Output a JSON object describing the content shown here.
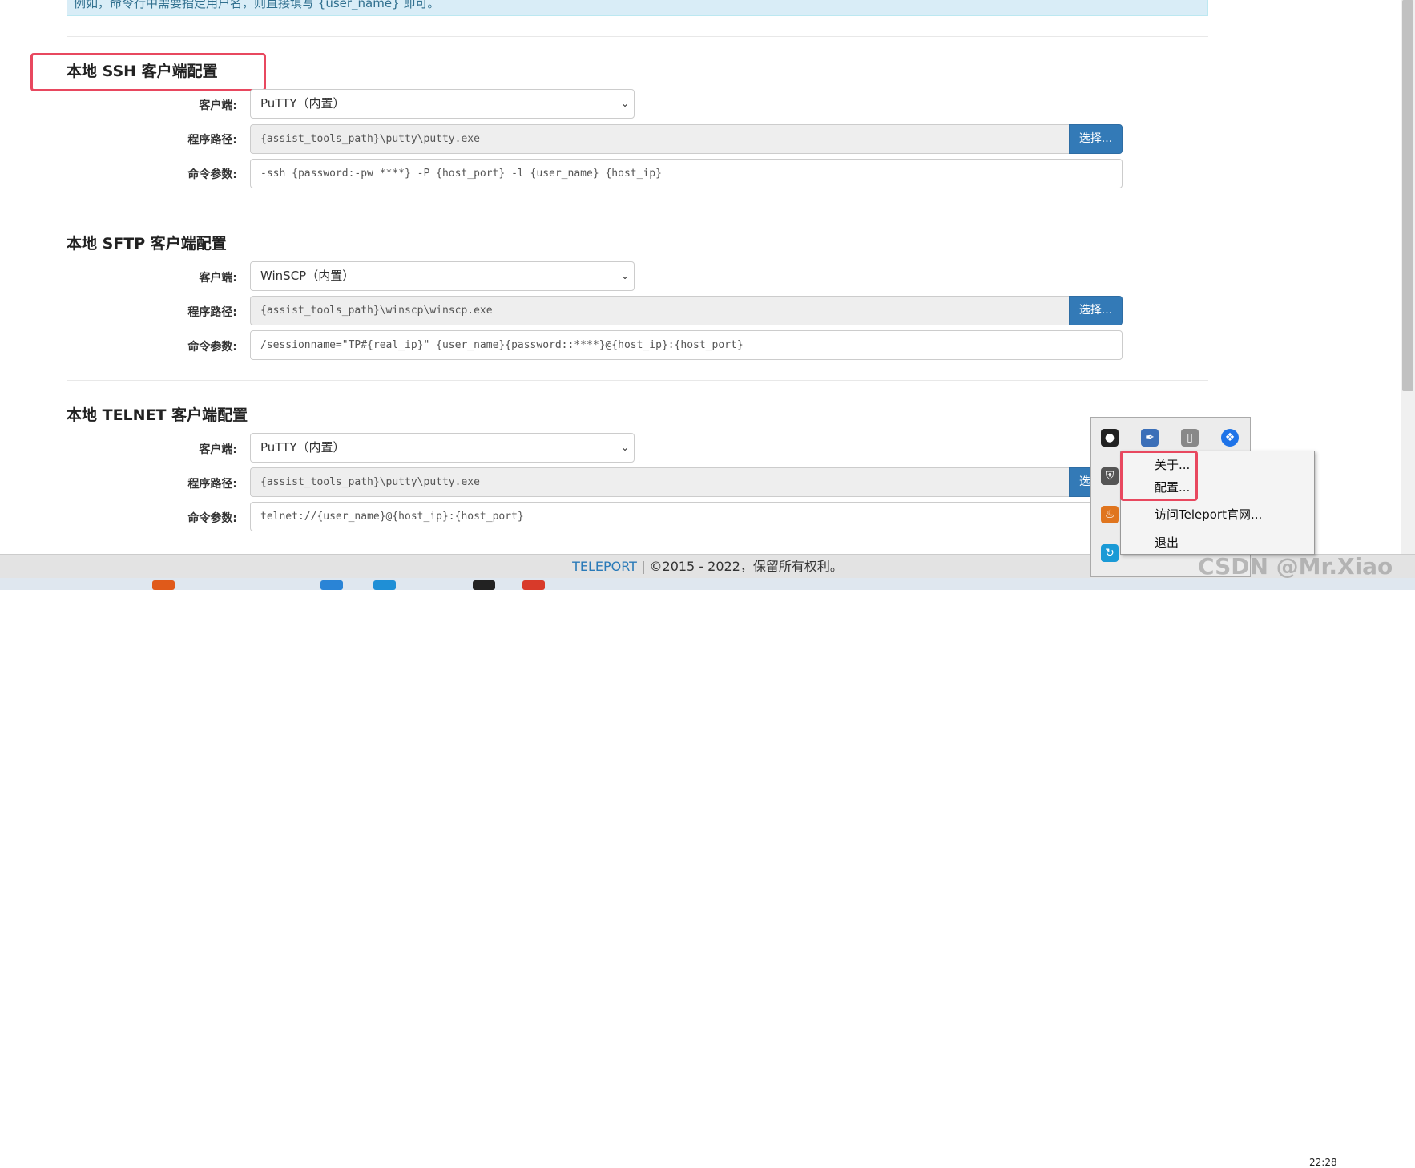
{
  "notice": {
    "text": "例如，命令行中需要指定用户名，则直接填写 {user_name} 即可。"
  },
  "sections": [
    {
      "title": "本地 SSH 客户端配置",
      "client_label": "客户端:",
      "client_value": "PuTTY（内置）",
      "path_label": "程序路径:",
      "path_value": "{assist_tools_path}\\putty\\putty.exe",
      "choose_label": "选择...",
      "args_label": "命令参数:",
      "args_value": "-ssh {password:-pw ****} -P {host_port} -l {user_name} {host_ip}"
    },
    {
      "title": "本地 SFTP 客户端配置",
      "client_label": "客户端:",
      "client_value": "WinSCP（内置）",
      "path_label": "程序路径:",
      "path_value": "{assist_tools_path}\\winscp\\winscp.exe",
      "choose_label": "选择...",
      "args_label": "命令参数:",
      "args_value": "/sessionname=\"TP#{real_ip}\" {user_name}{password::****}@{host_ip}:{host_port}"
    },
    {
      "title": "本地 TELNET 客户端配置",
      "client_label": "客户端:",
      "client_value": "PuTTY（内置）",
      "path_label": "程序路径:",
      "path_value": "{assist_tools_path}\\putty\\putty.exe",
      "choose_label": "选",
      "args_label": "命令参数:",
      "args_value": "telnet://{user_name}@{host_ip}:{host_port}"
    }
  ],
  "footer": {
    "brand": "TELEPORT",
    "text": " | ©2015 - 2022，保留所有权利。"
  },
  "context_menu": {
    "items": [
      "关于...",
      "配置...",
      "访问Teleport官网...",
      "退出"
    ]
  },
  "tray_icons": [
    "qq-icon",
    "pen-icon",
    "usb-icon",
    "bluetooth-icon",
    "security-icon",
    "java-icon",
    "swirl-icon"
  ],
  "watermark": "CSDN @Mr.Xiao",
  "clock": "22:28",
  "colors": {
    "highlight": "#e8485f",
    "primary": "#337ab7",
    "brand": "#2a7ab8"
  }
}
